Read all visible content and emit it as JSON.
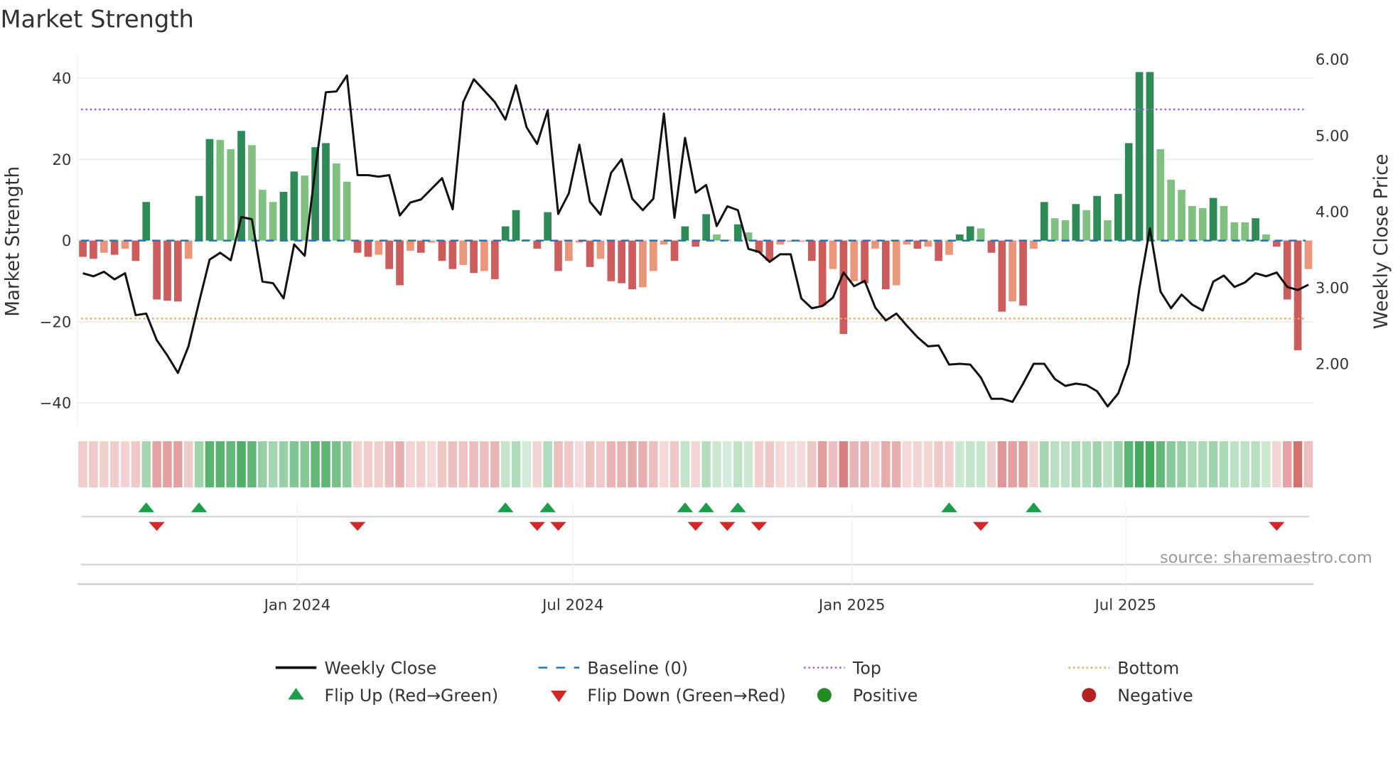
{
  "chart_data": {
    "type": "bar",
    "title": "Market Strength",
    "ylabel": "Market Strength",
    "y2label": "Weekly Close Price",
    "ylim": [
      -45,
      45
    ],
    "y2lim": [
      1.3,
      6.25
    ],
    "yticks": [
      {
        "v": 40,
        "label": "40"
      },
      {
        "v": 20,
        "label": "20"
      },
      {
        "v": 0,
        "label": "0"
      },
      {
        "v": -20,
        "label": "−20"
      },
      {
        "v": -40,
        "label": "−40"
      }
    ],
    "y2ticks": [
      {
        "v": 6,
        "label": "6.00"
      },
      {
        "v": 5,
        "label": "5.00"
      },
      {
        "v": 4,
        "label": "4.00"
      },
      {
        "v": 3,
        "label": "3.00"
      },
      {
        "v": 2,
        "label": "2.00"
      }
    ],
    "xticks": [
      {
        "week": 20.3,
        "label": "Jan 2024"
      },
      {
        "week": 46.4,
        "label": "Jul 2024"
      },
      {
        "week": 72.8,
        "label": "Jan 2025"
      },
      {
        "week": 98.7,
        "label": "Jul 2025"
      }
    ],
    "top_level": 32.3,
    "bottom_level": -19.2,
    "baseline": 0,
    "strength": [
      -4,
      -4.5,
      -3,
      -3.5,
      -2,
      -5,
      9.5,
      -14.5,
      -14.8,
      -15,
      -4.5,
      11,
      25,
      24.8,
      22.5,
      27,
      23.5,
      12.5,
      9.5,
      12,
      17,
      16,
      23,
      24,
      19,
      14.5,
      -3,
      -4,
      -3.5,
      -7,
      -11,
      -2.5,
      -3,
      -0.5,
      -5,
      -7,
      -6,
      -8,
      -7.5,
      -9.5,
      3.5,
      7.5,
      0.3,
      -2,
      7,
      -7.5,
      -5,
      -0.5,
      -6.5,
      -4.5,
      -10,
      -10.5,
      -12,
      -11.5,
      -7.5,
      -1,
      -5,
      3.5,
      -1.5,
      6.5,
      1.5,
      0.2,
      4,
      2,
      -3,
      -5,
      -1,
      -0.3,
      -0.3,
      -5,
      -16,
      -7,
      -23,
      -10,
      -10.5,
      -2,
      -12,
      -11,
      -1,
      -2,
      -1.5,
      -5,
      -3.5,
      1.5,
      3.5,
      3,
      -3,
      -17.5,
      -15,
      -16,
      -2,
      9.5,
      5.5,
      5,
      9,
      7.5,
      11,
      5,
      11.5,
      24,
      41.5,
      41.5,
      22.5,
      15,
      12.5,
      8.5,
      8,
      10.5,
      8.5,
      4.5,
      4.5,
      5.5,
      1.5,
      -1.5,
      -14.5,
      -27,
      -7
    ],
    "strong": [
      1,
      1,
      0,
      1,
      0,
      1,
      1,
      1,
      1,
      1,
      0,
      1,
      1,
      0,
      0,
      1,
      0,
      0,
      0,
      1,
      1,
      0,
      1,
      1,
      0,
      0,
      1,
      1,
      0,
      1,
      1,
      0,
      1,
      0,
      1,
      1,
      0,
      1,
      0,
      1,
      1,
      1,
      0,
      1,
      1,
      1,
      0,
      0,
      1,
      0,
      1,
      1,
      1,
      0,
      0,
      0,
      1,
      1,
      1,
      1,
      0,
      0,
      1,
      0,
      1,
      1,
      0,
      0,
      0,
      1,
      1,
      0,
      1,
      0,
      1,
      0,
      1,
      0,
      0,
      1,
      0,
      1,
      0,
      1,
      1,
      0,
      1,
      1,
      0,
      1,
      0,
      1,
      0,
      0,
      1,
      0,
      1,
      0,
      1,
      1,
      1,
      1,
      0,
      0,
      0,
      0,
      0,
      1,
      0,
      0,
      0,
      1,
      0,
      1,
      1,
      1,
      0
    ],
    "weekly_close": [
      3.19,
      3.15,
      3.21,
      3.11,
      3.19,
      2.64,
      2.66,
      2.31,
      2.11,
      1.88,
      2.23,
      2.81,
      3.37,
      3.46,
      3.36,
      3.93,
      3.9,
      3.08,
      3.06,
      2.86,
      3.57,
      3.42,
      4.56,
      5.57,
      5.58,
      5.79,
      4.48,
      4.48,
      4.46,
      4.48,
      3.95,
      4.12,
      4.16,
      4.3,
      4.44,
      4.03,
      5.44,
      5.74,
      5.59,
      5.44,
      5.21,
      5.66,
      5.11,
      4.89,
      5.33,
      3.97,
      4.24,
      4.88,
      4.13,
      3.96,
      4.51,
      4.69,
      4.17,
      4.02,
      4.17,
      5.29,
      3.92,
      4.97,
      4.25,
      4.35,
      3.81,
      4.07,
      4.02,
      3.51,
      3.47,
      3.34,
      3.44,
      3.44,
      2.86,
      2.73,
      2.76,
      2.87,
      3.2,
      3.02,
      3.09,
      2.74,
      2.57,
      2.66,
      2.5,
      2.35,
      2.23,
      2.24,
      1.99,
      2.0,
      1.99,
      1.82,
      1.54,
      1.54,
      1.5,
      1.74,
      2.0,
      2.0,
      1.8,
      1.71,
      1.74,
      1.72,
      1.64,
      1.44,
      1.61,
      2.0,
      2.99,
      3.78,
      2.95,
      2.73,
      2.91,
      2.78,
      2.7,
      3.08,
      3.16,
      3.01,
      3.07,
      3.19,
      3.15,
      3.2,
      3.01,
      2.97,
      3.04
    ],
    "flip_up_weeks": [
      6,
      11,
      40,
      44,
      57,
      59,
      62,
      82,
      90
    ],
    "flip_down_weeks": [
      7,
      26,
      43,
      45,
      58,
      61,
      64,
      85,
      113
    ],
    "colors": {
      "pos_strong": "#2e8b57",
      "pos_weak": "#80c080",
      "neg_strong": "#cd5c5c",
      "neg_weak": "#e9967a",
      "line": "#111111",
      "baseline": "#1f77b4",
      "top": "#9467dd",
      "bottom": "#f4a460",
      "flip_up": "#1a9e4a",
      "flip_down": "#d62728",
      "positive": "#228b22",
      "negative": "#b22222"
    },
    "legend": [
      {
        "key": "line",
        "label": "Weekly Close"
      },
      {
        "key": "baseline",
        "label": "Baseline (0)"
      },
      {
        "key": "top",
        "label": "Top"
      },
      {
        "key": "bottom",
        "label": "Bottom"
      },
      {
        "key": "flip_up",
        "label": "Flip Up (Red→Green)"
      },
      {
        "key": "flip_down",
        "label": "Flip Down (Green→Red)"
      },
      {
        "key": "positive",
        "label": "Positive"
      },
      {
        "key": "negative",
        "label": "Negative"
      }
    ],
    "source": "source: sharemaestro.com"
  }
}
